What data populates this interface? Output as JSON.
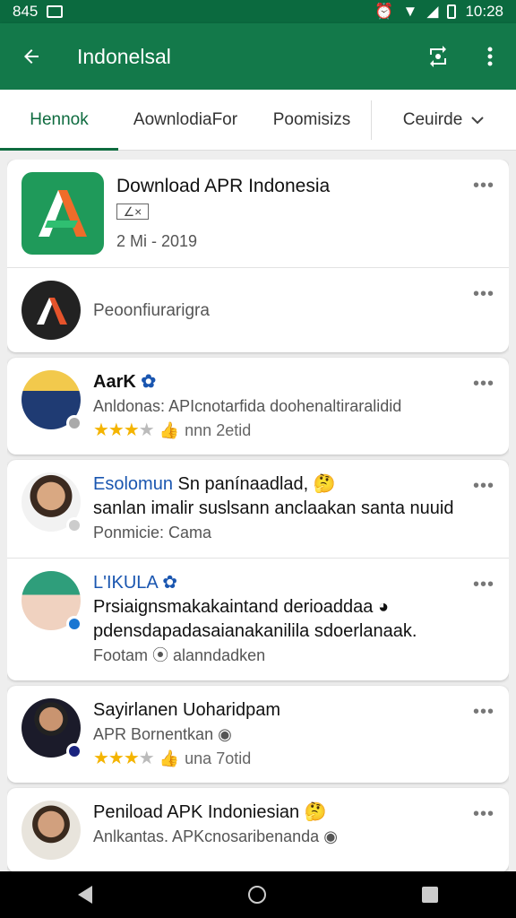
{
  "status": {
    "time_left": "845",
    "time_right": "10:28"
  },
  "appbar": {
    "title": "Indonelsal"
  },
  "tabs": [
    "Hennok",
    "AownlodiaFor",
    "Poomisizs",
    "Ceuirde"
  ],
  "app_card": {
    "title": "Download APR Indonesia",
    "badge": "∠×",
    "date": "2  Mi - 2019",
    "secondary": "Peoonfiurarigra"
  },
  "posts": [
    {
      "name": "AarK",
      "line": "Anldonas: APIcnotarfida doohenaltiraralidid",
      "rating_text": "nnn  2etid",
      "stars": 3
    },
    {
      "name": "Esolomun",
      "line1": "Sn panínaadlad,",
      "line2": "sanlan imalir suslsann anclaakan santa nuuid",
      "footer": "Ponmicie: Cama"
    },
    {
      "name": "L'IKULA",
      "line1": "Prsiaignsmakakaintand derioaddaa",
      "line2": "pdensdapadasaianakanilila sdoerlanaak.",
      "footer": "Footam  ⦿  alanndadken"
    },
    {
      "name": "Sayirlanen Uoharidpam",
      "line": "APR Bornentkan",
      "rating_text": "una  7otid",
      "stars": 3
    },
    {
      "name": "Peniload APK Indoniesian",
      "line": "Anlkantas. APKcnosaribenanda"
    }
  ]
}
